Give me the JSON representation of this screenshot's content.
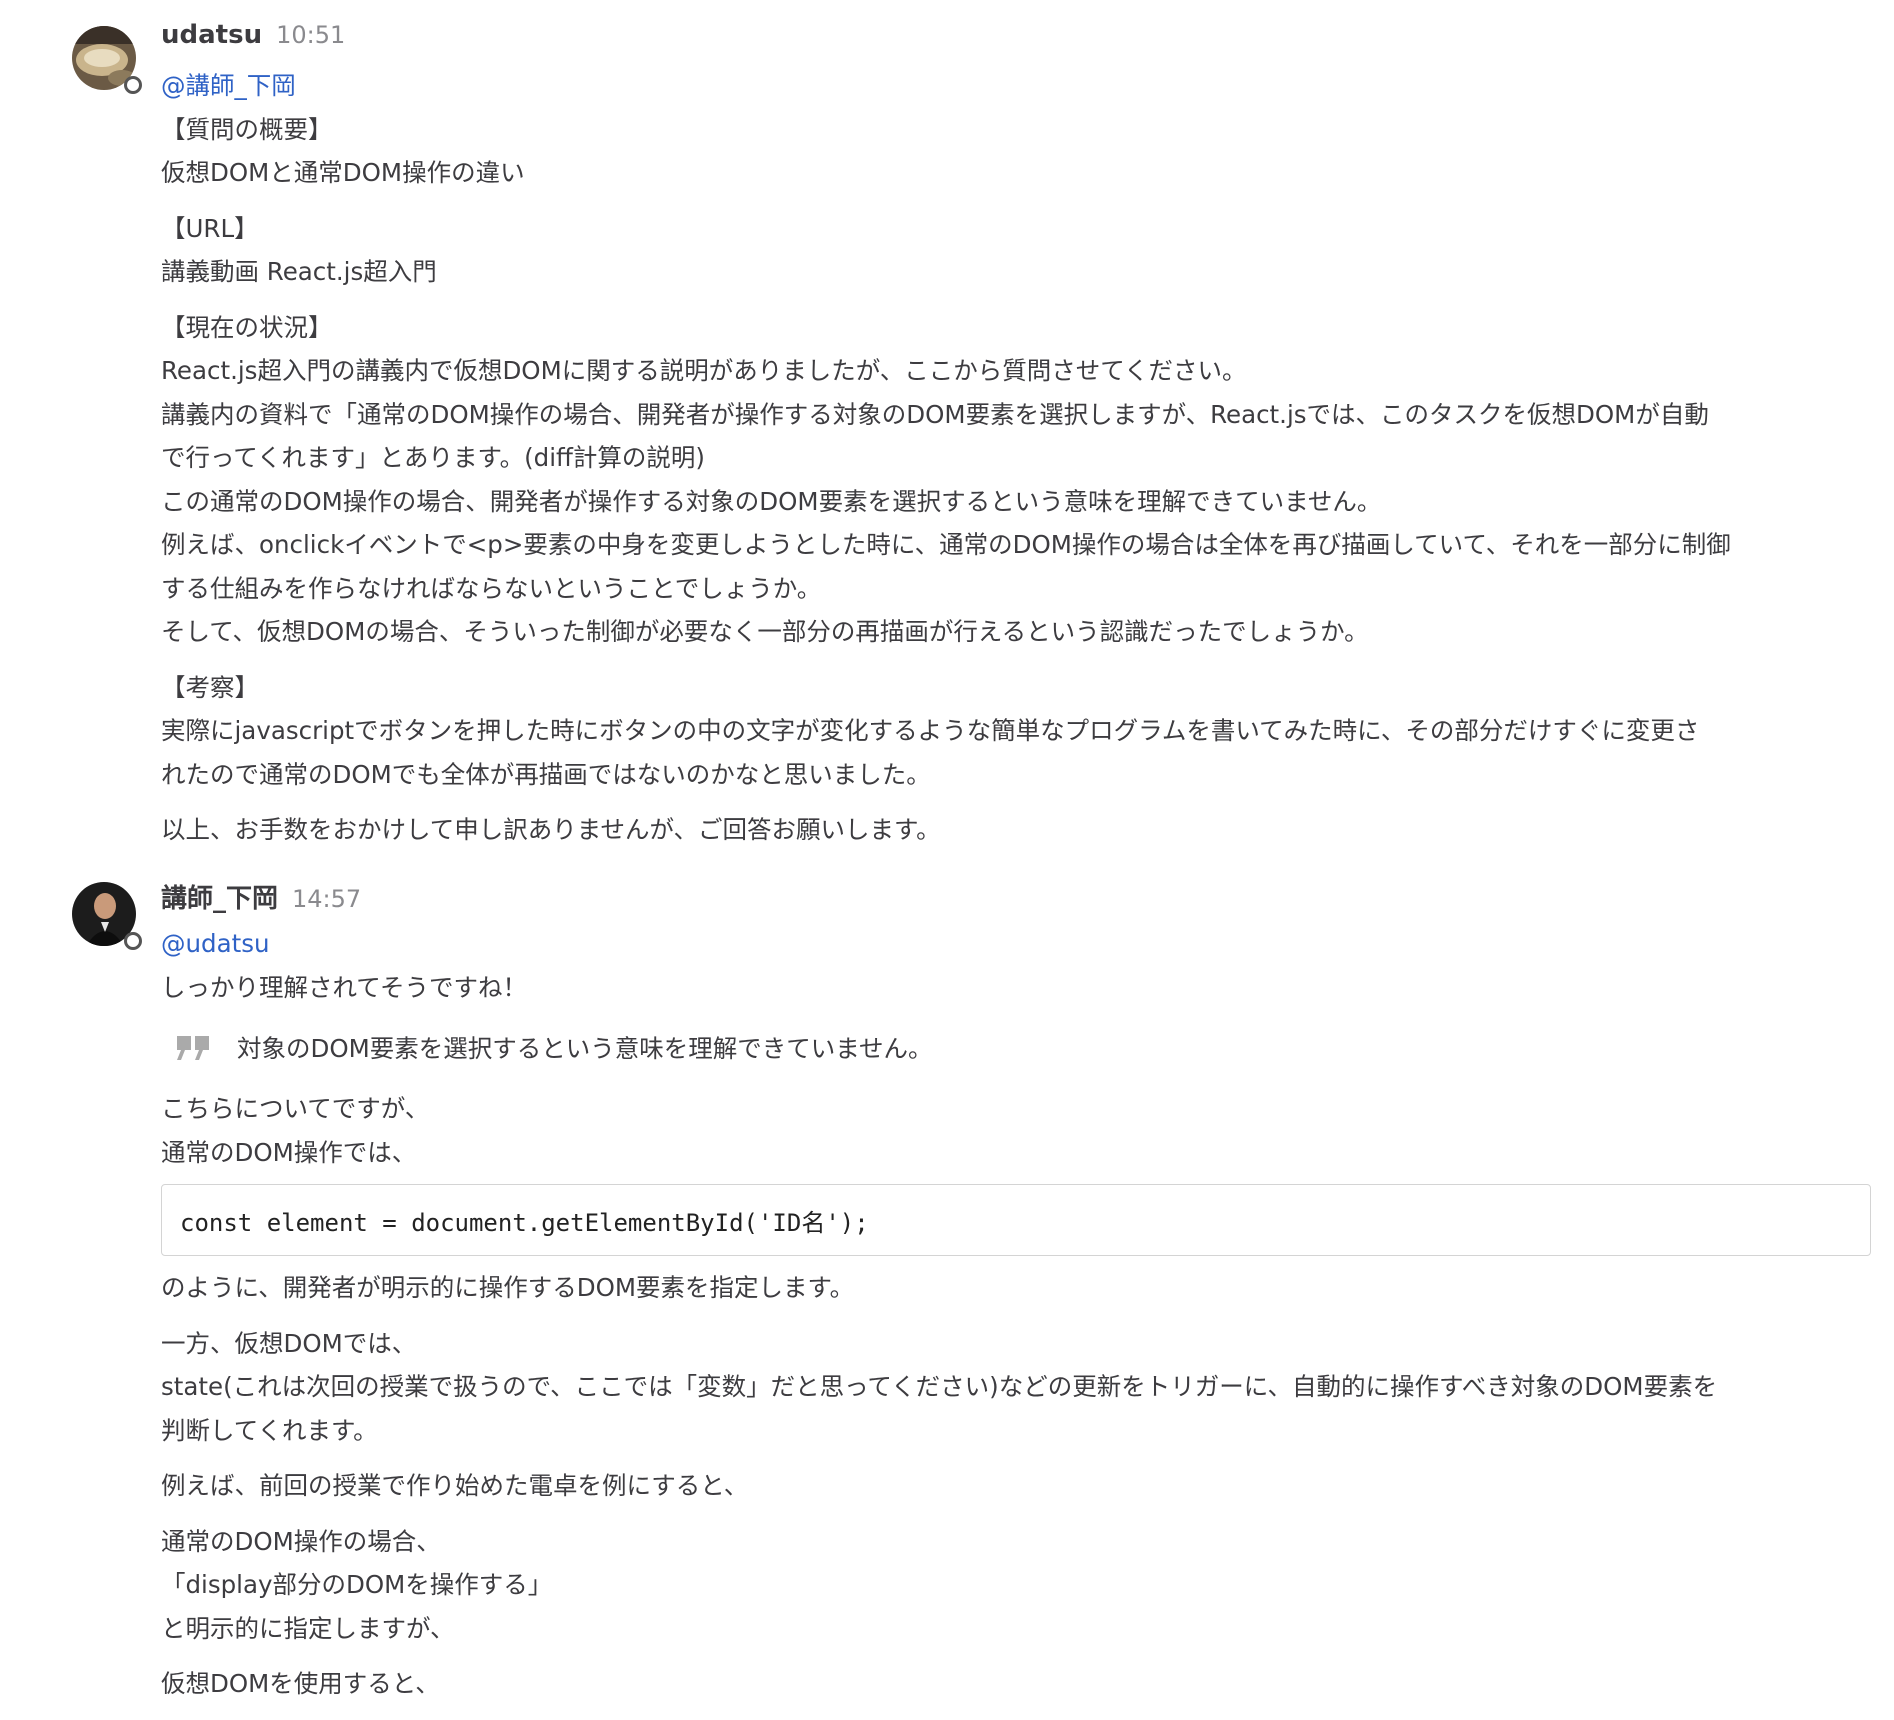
{
  "posts": [
    {
      "username": "udatsu",
      "time": "10:51",
      "mention": "@講師_下岡",
      "paragraphs": [
        [
          "【質問の概要】",
          "仮想DOMと通常DOM操作の違い"
        ],
        [
          "【URL】",
          "講義動画 React.js超入門"
        ],
        [
          "【現在の状況】",
          "React.js超入門の講義内で仮想DOMに関する説明がありましたが、ここから質問させてください。",
          "講義内の資料で「通常のDOM操作の場合、開発者が操作する対象のDOM要素を選択しますが、React.jsでは、このタスクを仮想DOMが自動",
          "で行ってくれます」とあります。(diff計算の説明)",
          "この通常のDOM操作の場合、開発者が操作する対象のDOM要素を選択するという意味を理解できていません。",
          "例えば、onclickイベントで<p>要素の中身を変更しようとした時に、通常のDOM操作の場合は全体を再び描画していて、それを一部分に制御",
          "する仕組みを作らなければならないということでしょうか。",
          "そして、仮想DOMの場合、そういった制御が必要なく一部分の再描画が行えるという認識だったでしょうか。"
        ],
        [
          "【考察】",
          "実際にjavascriptでボタンを押した時にボタンの中の文字が変化するような簡単なプログラムを書いてみた時に、その部分だけすぐに変更さ",
          "れたので通常のDOMでも全体が再描画ではないのかなと思いました。"
        ],
        [
          "以上、お手数をおかけして申し訳ありませんが、ご回答お願いします。"
        ]
      ]
    },
    {
      "username": "講師_下岡",
      "time": "14:57",
      "mention": "@udatsu",
      "line1": "しっかり理解されてそうですね！",
      "quote": "対象のDOM要素を選択するという意味を理解できていません。",
      "para_a": [
        "こちらについてですが、",
        "通常のDOM操作では、"
      ],
      "code": "const element = document.getElementById('ID名');",
      "para_b": "のように、開発者が明示的に操作するDOM要素を指定します。",
      "para_c": [
        "一方、仮想DOMでは、",
        "state(これは次回の授業で扱うので、ここでは「変数」だと思ってください)などの更新をトリガーに、自動的に操作すべき対象のDOM要素を",
        "判断してくれます。"
      ],
      "para_d": "例えば、前回の授業で作り始めた電卓を例にすると、",
      "para_e": [
        "通常のDOM操作の場合、",
        "「display部分のDOMを操作する」",
        "と明示的に指定しますが、"
      ],
      "para_f": "仮想DOMを使用すると、"
    }
  ]
}
